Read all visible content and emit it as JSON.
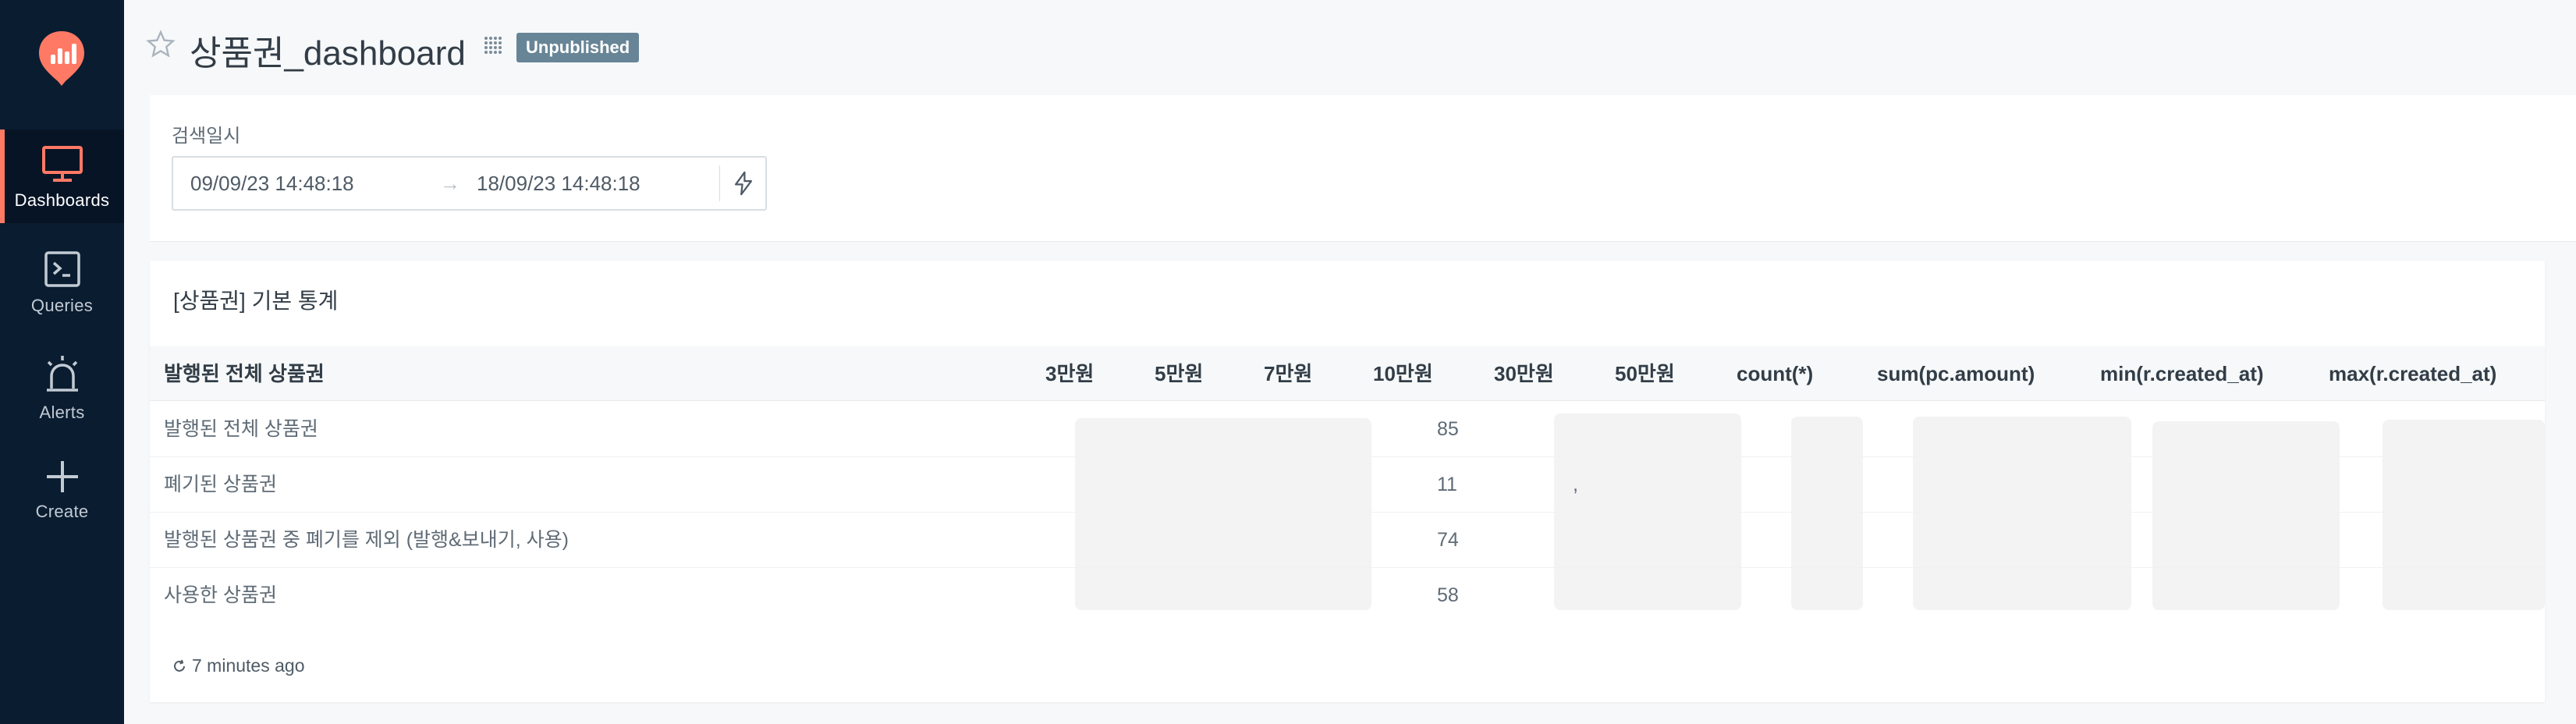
{
  "sidebar": {
    "items": [
      {
        "label": "Dashboards",
        "icon": "monitor-icon"
      },
      {
        "label": "Queries",
        "icon": "terminal-icon"
      },
      {
        "label": "Alerts",
        "icon": "alarm-icon"
      },
      {
        "label": "Create",
        "icon": "plus-icon"
      }
    ]
  },
  "header": {
    "title": "상품권_dashboard",
    "badge": "Unpublished"
  },
  "filter": {
    "label": "검색일시",
    "start": "09/09/23 14:48:18",
    "arrow": "→",
    "end": "18/09/23 14:48:18"
  },
  "widget": {
    "title": "[상품권] 기본 통계",
    "columns": [
      "발행된 전체 상품권",
      "3만원",
      "5만원",
      "7만원",
      "10만원",
      "30만원",
      "50만원",
      "count(*)",
      "sum(pc.amount)",
      "min(r.created_at)",
      "max(r.created_at)"
    ],
    "rows": [
      {
        "label": "발행된 전체 상품권",
        "v10": "85"
      },
      {
        "label": "폐기된 상품권",
        "v10": "11",
        "v30": ","
      },
      {
        "label": "발행된 상품권 중 폐기를 제외 (발행&보내기, 사용)",
        "v10": "74"
      },
      {
        "label": "사용한 상품권",
        "v10": "58"
      }
    ],
    "refreshed": "7 minutes ago"
  },
  "colors": {
    "sidebar_bg": "#0a1c30",
    "accent": "#ff7964",
    "badge": "#688597"
  }
}
